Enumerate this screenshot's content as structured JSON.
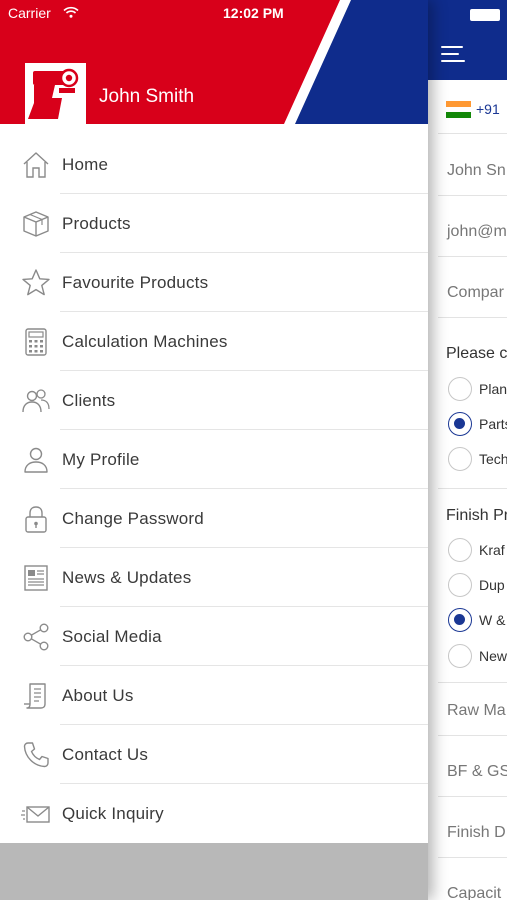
{
  "status_bar": {
    "carrier": "Carrier",
    "time": "12:02 PM"
  },
  "drawer": {
    "user_name": "John Smith",
    "colors": {
      "red": "#d8001a",
      "blue": "#0f2c8c",
      "footer": "#b8b8b8"
    },
    "items": [
      {
        "label": "Home",
        "icon": "home-icon"
      },
      {
        "label": "Products",
        "icon": "box-icon"
      },
      {
        "label": "Favourite Products",
        "icon": "star-icon"
      },
      {
        "label": "Calculation Machines",
        "icon": "calculator-icon"
      },
      {
        "label": "Clients",
        "icon": "users-icon"
      },
      {
        "label": "My Profile",
        "icon": "user-icon"
      },
      {
        "label": "Change Password",
        "icon": "lock-icon"
      },
      {
        "label": "News & Updates",
        "icon": "newspaper-icon"
      },
      {
        "label": "Social Media",
        "icon": "share-icon"
      },
      {
        "label": "About Us",
        "icon": "document-icon"
      },
      {
        "label": "Contact Us",
        "icon": "phone-icon"
      },
      {
        "label": "Quick Inquiry",
        "icon": "envelope-icon"
      }
    ]
  },
  "background_form": {
    "phone_code": "+91",
    "name_placeholder": "John Sn",
    "email_placeholder": "john@m",
    "company_placeholder": "Compar",
    "section1_title": "Please c",
    "section1_options": [
      {
        "label": "Plan",
        "selected": false
      },
      {
        "label": "Parts",
        "selected": true
      },
      {
        "label": "Tech",
        "selected": false
      }
    ],
    "section2_title": "Finish Pr",
    "section2_options": [
      {
        "label": "Kraf",
        "selected": false
      },
      {
        "label": "Dup",
        "selected": false
      },
      {
        "label": "W &",
        "selected": true
      },
      {
        "label": "New",
        "selected": false
      }
    ],
    "raw_material": "Raw Ma",
    "bf_gsm": "BF & GS",
    "finish_d": "Finish D",
    "capacity": "Capacit"
  }
}
